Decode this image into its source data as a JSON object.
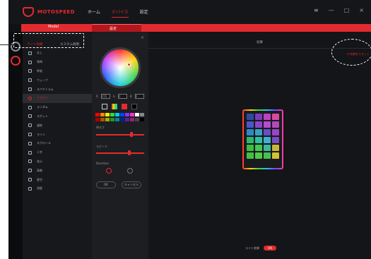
{
  "brand": {
    "logo_text": "MOTOSPEED",
    "accent": "#e32b2f"
  },
  "nav": [
    "ホーム",
    "デバイス",
    "設定"
  ],
  "window_controls": [
    "≡",
    "—",
    "□",
    "×"
  ],
  "model_label": "Model",
  "device_tab": "設定",
  "modes": [
    "ライト効果",
    "カスタム照明"
  ],
  "menu": [
    "なし",
    "常時",
    "呼吸",
    "ウェーブ",
    "スペクトラム",
    "リアクト",
    "ランダム",
    "スポット",
    "波紋",
    "ライン",
    "スクロール",
    "十字",
    "花火",
    "渦巻",
    "星空",
    "流星"
  ],
  "selected_menu_index": 5,
  "color_panel": {
    "rgb_labels": [
      "R",
      "G",
      "B"
    ],
    "rgb_values": [
      "255",
      "0",
      "0"
    ],
    "brightness_label": "明るさ",
    "speed_label": "スピード",
    "direction_label": "Direction",
    "brightness_value_pct": 75,
    "speed_value_pct": 70,
    "buttons": [
      "OK",
      "キャンセル"
    ],
    "swatches": [
      "#ff0000",
      "#ff8800",
      "#ffee00",
      "#33dd33",
      "#00ccff",
      "#0044ff",
      "#8833ff",
      "#ff33cc",
      "#ffffff",
      "#888888",
      "#aa0000",
      "#aa5500",
      "#aaaa00",
      "#229922",
      "#008899",
      "#002299",
      "#552299",
      "#992277",
      "#444444",
      "#000000"
    ]
  },
  "main": {
    "header": "効果",
    "link": "↺ 効果をリセット",
    "key_colors": [
      "#2d4b9e",
      "#7a3bb8",
      "#c23fbf",
      "#d84aa0",
      "#4a56c8",
      "#8a45c9",
      "#b64ad0",
      "#b04ab8",
      "#2a8ac8",
      "#3aa0c0",
      "#6a4ec6",
      "#9a44c6",
      "#2db870",
      "#30c0a0",
      "#40b0d0",
      "#7a4ec0",
      "#38c040",
      "#40c850",
      "#3ab8a0",
      "#c8b838",
      "#40c040",
      "#50c848",
      "#48c050",
      "#d8c030"
    ],
    "toggle_label": "ライト効果",
    "toggle_state": "ON"
  }
}
